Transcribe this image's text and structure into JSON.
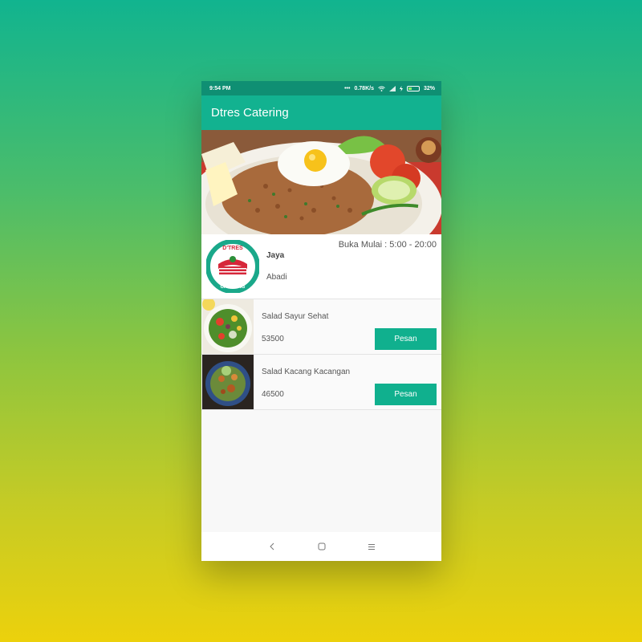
{
  "status_bar": {
    "time": "9:54 PM",
    "network_speed": "0.78K/s",
    "battery": "32%",
    "icons": [
      "dots-icon",
      "wifi-icon",
      "signal-icon",
      "charging-icon",
      "battery-icon"
    ]
  },
  "app_bar": {
    "title": "Dtres Catering"
  },
  "hero": {
    "image": "fried-rice-with-egg-banner"
  },
  "restaurant": {
    "logo_icon": "dtres-catering-logo",
    "logo_text_top": "D'TRES",
    "logo_text_bottom": "CATERING",
    "name": "Jaya",
    "subtitle": "Abadi",
    "hours": "Buka Mulai : 5:00 - 20:00"
  },
  "menu": {
    "items": [
      {
        "name": "Salad Sayur Sehat",
        "price": "53500",
        "button": "Pesan",
        "image": "vegetable-salad-photo"
      },
      {
        "name": "Salad Kacang Kacangan",
        "price": "46500",
        "button": "Pesan",
        "image": "bean-salad-photo"
      }
    ]
  },
  "nav_bar": {
    "icons": [
      "back-icon",
      "home-icon",
      "menu-icon"
    ]
  },
  "colors": {
    "primary": "#12b290",
    "status": "#0f8f73",
    "button": "#10b08e"
  }
}
